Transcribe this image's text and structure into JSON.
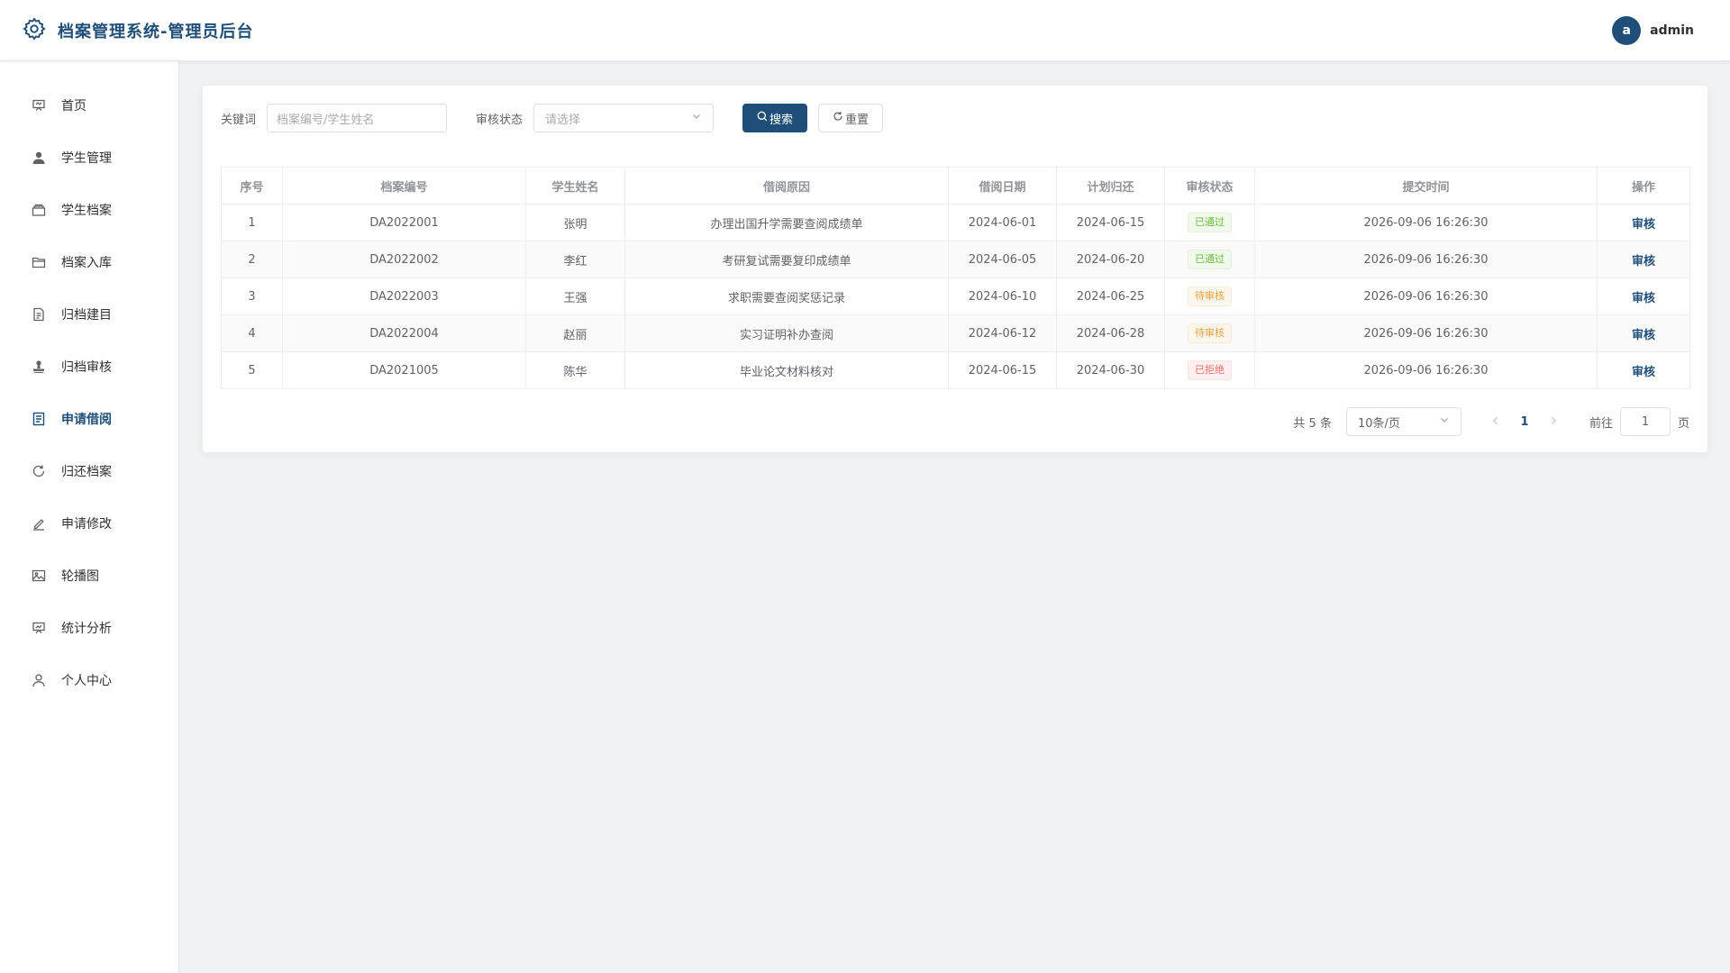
{
  "header": {
    "title": "档案管理系统-管理员后台",
    "user": {
      "initial": "a",
      "name": "admin"
    }
  },
  "sidebar": {
    "items": [
      {
        "label": "首页",
        "icon": "presentation-icon"
      },
      {
        "label": "学生管理",
        "icon": "user-filled-icon"
      },
      {
        "label": "学生档案",
        "icon": "box-icon"
      },
      {
        "label": "档案入库",
        "icon": "folder-icon"
      },
      {
        "label": "归档建目",
        "icon": "document-icon"
      },
      {
        "label": "归档审核",
        "icon": "stamp-icon"
      },
      {
        "label": "申请借阅",
        "icon": "tickets-icon",
        "active": true
      },
      {
        "label": "归还档案",
        "icon": "refresh-icon"
      },
      {
        "label": "申请修改",
        "icon": "edit-pen-icon"
      },
      {
        "label": "轮播图",
        "icon": "picture-icon"
      },
      {
        "label": "统计分析",
        "icon": "data-board-icon"
      },
      {
        "label": "个人中心",
        "icon": "user-icon"
      }
    ]
  },
  "search": {
    "keyword_label": "关键词",
    "keyword_placeholder": "档案编号/学生姓名",
    "status_label": "审核状态",
    "status_placeholder": "请选择",
    "search_button": "搜索",
    "reset_button": "重置"
  },
  "table": {
    "columns": [
      "序号",
      "档案编号",
      "学生姓名",
      "借阅原因",
      "借阅日期",
      "计划归还",
      "审核状态",
      "提交时间",
      "操作"
    ],
    "rows": [
      {
        "no": "1",
        "code": "DA2022001",
        "name": "张明",
        "reason": "办理出国升学需要查阅成绩单",
        "borrow_date": "2024-06-01",
        "return_date": "2024-06-15",
        "status": "已通过",
        "status_type": "ok",
        "submit_time": "2026-09-06 16:26:30",
        "action": "审核"
      },
      {
        "no": "2",
        "code": "DA2022002",
        "name": "李红",
        "reason": "考研复试需要复印成绩单",
        "borrow_date": "2024-06-05",
        "return_date": "2024-06-20",
        "status": "已通过",
        "status_type": "ok",
        "submit_time": "2026-09-06 16:26:30",
        "action": "审核"
      },
      {
        "no": "3",
        "code": "DA2022003",
        "name": "王强",
        "reason": "求职需要查阅奖惩记录",
        "borrow_date": "2024-06-10",
        "return_date": "2024-06-25",
        "status": "待审核",
        "status_type": "wait",
        "submit_time": "2026-09-06 16:26:30",
        "action": "审核"
      },
      {
        "no": "4",
        "code": "DA2022004",
        "name": "赵丽",
        "reason": "实习证明补办查阅",
        "borrow_date": "2024-06-12",
        "return_date": "2024-06-28",
        "status": "待审核",
        "status_type": "wait",
        "submit_time": "2026-09-06 16:26:30",
        "action": "审核"
      },
      {
        "no": "5",
        "code": "DA2021005",
        "name": "陈华",
        "reason": "毕业论文材料核对",
        "borrow_date": "2024-06-15",
        "return_date": "2024-06-30",
        "status": "已拒绝",
        "status_type": "no",
        "submit_time": "2026-09-06 16:26:30",
        "action": "审核"
      }
    ]
  },
  "pagination": {
    "total_text": "共 5 条",
    "page_size": "10条/页",
    "current_page": "1",
    "goto_label": "前往",
    "goto_value": "1",
    "page_suffix": "页"
  },
  "colors": {
    "primary": "#1f4e79",
    "success": "#67c23a",
    "warning": "#e6a23c",
    "danger": "#f56c6c"
  }
}
